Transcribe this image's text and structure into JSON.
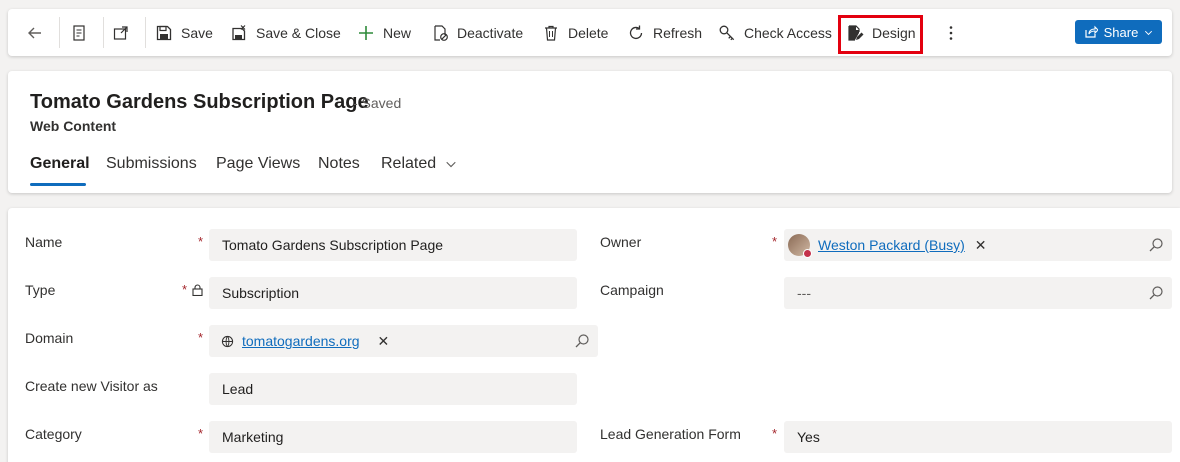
{
  "toolbar": {
    "save": "Save",
    "save_close": "Save & Close",
    "new": "New",
    "deactivate": "Deactivate",
    "delete": "Delete",
    "refresh": "Refresh",
    "check_access": "Check Access",
    "design": "Design",
    "share": "Share"
  },
  "header": {
    "title": "Tomato Gardens Subscription Page",
    "saved": "- Saved",
    "entity": "Web Content",
    "tabs": [
      "General",
      "Submissions",
      "Page Views",
      "Notes",
      "Related"
    ]
  },
  "form": {
    "name": {
      "label": "Name",
      "value": "Tomato Gardens Subscription Page"
    },
    "type": {
      "label": "Type",
      "value": "Subscription"
    },
    "domain": {
      "label": "Domain",
      "value": "tomatogardens.org"
    },
    "visitor": {
      "label": "Create new Visitor as",
      "value": "Lead"
    },
    "category": {
      "label": "Category",
      "value": "Marketing"
    },
    "owner": {
      "label": "Owner",
      "value": "Weston Packard (Busy)"
    },
    "campaign": {
      "label": "Campaign",
      "value": "---"
    },
    "lead_form": {
      "label": "Lead Generation Form",
      "value": "Yes"
    }
  },
  "colors": {
    "accent": "#0f6cbd",
    "highlight": "#e3000f",
    "required": "#a4262c"
  }
}
